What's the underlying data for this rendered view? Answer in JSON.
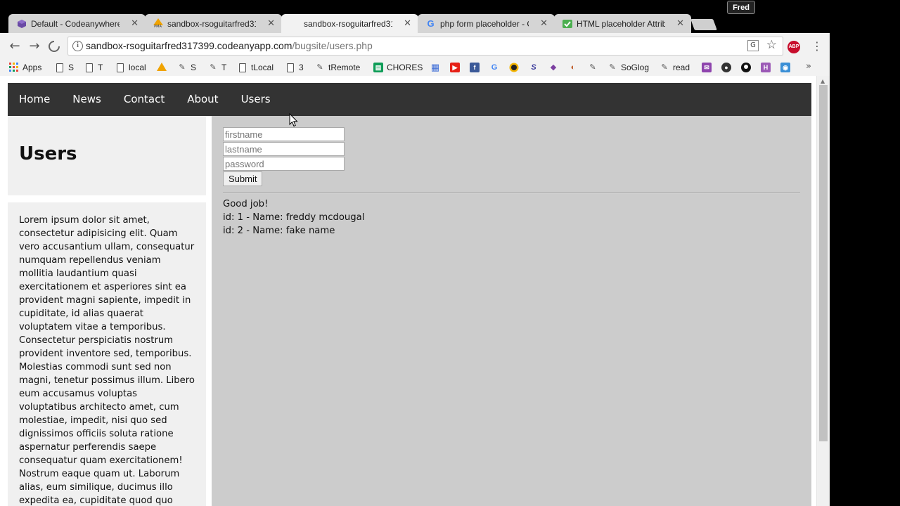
{
  "browser": {
    "profile_name": "Fred",
    "tabs": [
      {
        "title": "Default - Codeanywhere",
        "favicon": "codeanywhere-icon"
      },
      {
        "title": "sandbox-rsoguitarfred31",
        "favicon": "pma-icon",
        "favicon_text": "PMA"
      },
      {
        "title": "sandbox-rsoguitarfred31",
        "favicon": "none",
        "active": true
      },
      {
        "title": "php form placeholder - G",
        "favicon": "google-icon",
        "favicon_text": "G"
      },
      {
        "title": "HTML placeholder Attrib",
        "favicon": "w3schools-icon"
      }
    ],
    "url_host": "sandbox-rsoguitarfred317399.codeanyapp.com",
    "url_path": "/bugsite/users.php",
    "extension_label": "ABP",
    "bookmarks": [
      {
        "label": "Apps",
        "icon": "apps-grid-icon"
      },
      {
        "label": "S",
        "icon": "page-icon"
      },
      {
        "label": "T",
        "icon": "page-icon"
      },
      {
        "label": "local",
        "icon": "page-icon"
      },
      {
        "label": "",
        "icon": "pma-icon"
      },
      {
        "label": "S",
        "icon": "remote-icon"
      },
      {
        "label": "T",
        "icon": "remote-icon"
      },
      {
        "label": "tLocal",
        "icon": "page-icon"
      },
      {
        "label": "3",
        "icon": "page-icon"
      },
      {
        "label": "tRemote",
        "icon": "remote-icon"
      },
      {
        "label": "CHORES",
        "icon": "sheets-icon"
      },
      {
        "label": "",
        "icon": "grid-icon"
      },
      {
        "label": "",
        "icon": "youtube-icon"
      },
      {
        "label": "",
        "icon": "facebook-icon"
      },
      {
        "label": "",
        "icon": "google-icon",
        "icon_text": "G"
      },
      {
        "label": "",
        "icon": "circle-icon"
      },
      {
        "label": "",
        "icon": "s-icon"
      },
      {
        "label": "",
        "icon": "diamond-icon"
      },
      {
        "label": "",
        "icon": "half-circle-icon"
      },
      {
        "label": "",
        "icon": "remote-icon"
      },
      {
        "label": "SoGlog",
        "icon": "remote-icon"
      },
      {
        "label": "read",
        "icon": "remote-icon"
      },
      {
        "label": "",
        "icon": "twitch-icon"
      },
      {
        "label": "",
        "icon": "badge-icon"
      },
      {
        "label": "",
        "icon": "github-icon"
      },
      {
        "label": "",
        "icon": "h-icon",
        "icon_text": "H"
      },
      {
        "label": "",
        "icon": "camera-icon"
      }
    ],
    "colors": {
      "abp": "#c70d2c",
      "nav_bg": "#333333",
      "main_bg": "#cccccc",
      "sidebar_bg": "#f0f0f0"
    }
  },
  "site": {
    "nav": [
      "Home",
      "News",
      "Contact",
      "About",
      "Users"
    ],
    "page_title": "Users",
    "sidebar_text": "Lorem ipsum dolor sit amet, consectetur adipisicing elit. Quam vero accusantium ullam, consequatur numquam repellendus veniam mollitia laudantium quasi exercitationem et asperiores sint ea provident magni sapiente, impedit in cupiditate, id alias quaerat voluptatem vitae a temporibus. Consectetur perspiciatis nostrum provident inventore sed, temporibus. Molestias commodi sunt sed non magni, tenetur possimus illum. Libero eum accusamus voluptas voluptatibus architecto amet, cum molestiae, impedit, nisi quo sed dignissimos officiis soluta ratione aspernatur perferendis saepe consequatur quam exercitationem! Nostrum eaque quam ut. Laborum alias, eum similique, ducimus illo expedita ea, cupiditate quod quo magnam illum esse impedit",
    "form": {
      "firstname_placeholder": "firstname",
      "lastname_placeholder": "lastname",
      "password_placeholder": "password",
      "submit_label": "Submit"
    },
    "output": {
      "message": "Good job!",
      "rows": [
        "id: 1 - Name: freddy mcdougal",
        "id: 2 - Name: fake name"
      ]
    }
  }
}
